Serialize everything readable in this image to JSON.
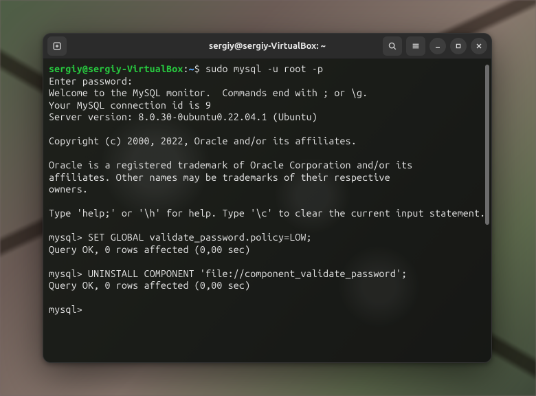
{
  "window": {
    "title": "sergiy@sergiy-VirtualBox: ~"
  },
  "prompt": {
    "user_host": "sergiy@sergiy-VirtualBox",
    "sep": ":",
    "path": "~",
    "dollar": "$ "
  },
  "session": {
    "command": "sudo mysql -u root -p",
    "enter_password": "Enter password:",
    "welcome": "Welcome to the MySQL monitor.  Commands end with ; or \\g.",
    "conn_id": "Your MySQL connection id is 9",
    "server_version": "Server version: 8.0.30-0ubuntu0.22.04.1 (Ubuntu)",
    "copyright": "Copyright (c) 2000, 2022, Oracle and/or its affiliates.",
    "trademark1": "Oracle is a registered trademark of Oracle Corporation and/or its",
    "trademark2": "affiliates. Other names may be trademarks of their respective",
    "trademark3": "owners.",
    "help": "Type 'help;' or '\\h' for help. Type '\\c' to clear the current input statement.",
    "mysql_prompt": "mysql> ",
    "stmt1": "SET GLOBAL validate_password.policy=LOW;",
    "ok1": "Query OK, 0 rows affected (0,00 sec)",
    "stmt2": "UNINSTALL COMPONENT 'file://component_validate_password';",
    "ok2": "Query OK, 0 rows affected (0,00 sec)"
  },
  "colors": {
    "prompt_user": "#27c93f",
    "prompt_path": "#5aa8ff",
    "text": "#e6e6e6",
    "titlebar_bg": "#2b2b2b"
  },
  "icons": {
    "new_tab": "new-tab-icon",
    "search": "search-icon",
    "menu": "hamburger-menu-icon",
    "minimize": "minimize-icon",
    "maximize": "maximize-icon",
    "close": "close-icon"
  }
}
